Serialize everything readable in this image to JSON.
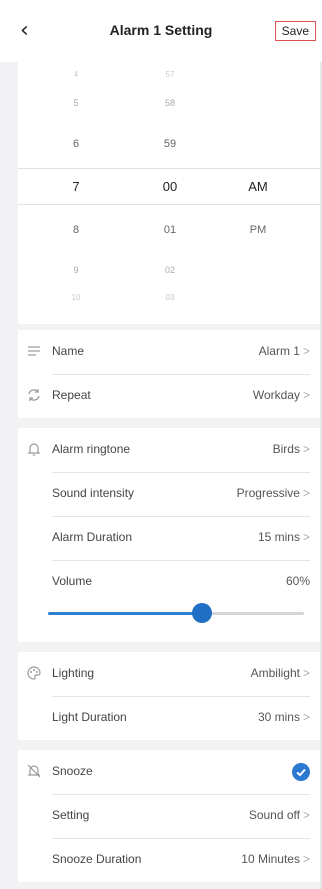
{
  "header": {
    "title": "Alarm 1 Setting",
    "save_label": "Save",
    "back_icon": "‹"
  },
  "picker": {
    "hours": [
      "4",
      "5",
      "6",
      "7",
      "8",
      "9",
      "10"
    ],
    "minutes": [
      "57",
      "58",
      "59",
      "00",
      "01",
      "02",
      "03"
    ],
    "ampm": [
      "AM",
      "PM"
    ],
    "selected": {
      "hour": "7",
      "minute": "00",
      "ampm": "AM"
    }
  },
  "rows": {
    "name": {
      "label": "Name",
      "value": "Alarm 1"
    },
    "repeat": {
      "label": "Repeat",
      "value": "Workday"
    },
    "ringtone": {
      "label": "Alarm ringtone",
      "value": "Birds"
    },
    "sound_intensity": {
      "label": "Sound intensity",
      "value": "Progressive"
    },
    "alarm_duration": {
      "label": "Alarm Duration",
      "value": "15 mins"
    },
    "volume": {
      "label": "Volume",
      "value": "60%",
      "level": 0.6
    },
    "lighting": {
      "label": "Lighting",
      "value": "Ambilight"
    },
    "light_duration": {
      "label": "Light Duration",
      "value": "30 mins"
    },
    "snooze": {
      "label": "Snooze",
      "enabled": true
    },
    "snooze_setting": {
      "label": "Setting",
      "value": "Sound off"
    },
    "snooze_duration": {
      "label": "Snooze Duration",
      "value": "10 Minutes"
    }
  },
  "chevron": ">",
  "colors": {
    "accent": "#2a78cf",
    "save_border": "#e05050"
  }
}
